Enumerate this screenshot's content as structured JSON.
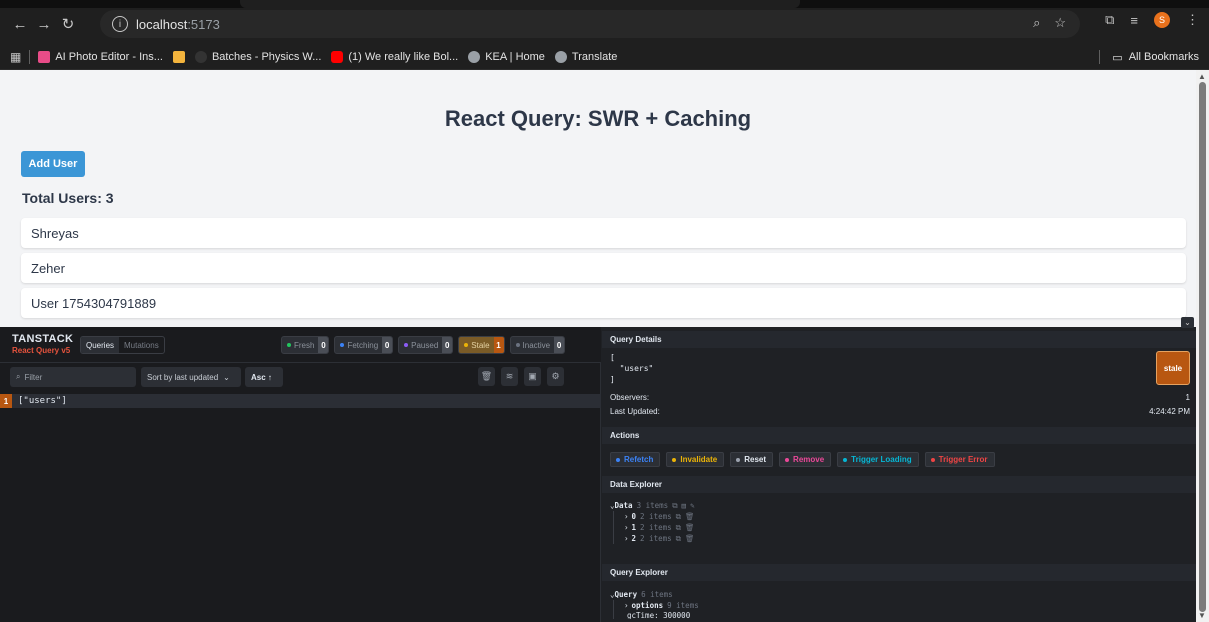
{
  "browser": {
    "url_host": "localhost",
    "url_port": ":5173",
    "bookmarks": [
      {
        "label": "AI Photo Editor - Ins...",
        "color": "#e84c88"
      },
      {
        "label": "",
        "color": "#f3b43d"
      },
      {
        "label": "Batches - Physics W...",
        "color": "#333333"
      },
      {
        "label": "(1) We really like Bol...",
        "color": "#ff0000"
      },
      {
        "label": "KEA | Home",
        "color": "#9aa0a6"
      },
      {
        "label": "Translate",
        "color": "#9aa0a6"
      }
    ],
    "all_bookmarks": "All Bookmarks",
    "avatar_letter": "S"
  },
  "page": {
    "title": "React Query: SWR + Caching",
    "add_button": "Add User",
    "total_users": "Total Users: 3",
    "users": [
      "Shreyas",
      "Zeher",
      "User 1754304791889"
    ]
  },
  "devtools": {
    "brand": "TANSTACK",
    "sub_brand": "React Query v5",
    "tabs": [
      "Queries",
      "Mutations"
    ],
    "badges": [
      {
        "label": "Fresh",
        "count": "0",
        "dot": "#22c55e"
      },
      {
        "label": "Fetching",
        "count": "0",
        "dot": "#3b82f6"
      },
      {
        "label": "Paused",
        "count": "0",
        "dot": "#8b5cf6"
      },
      {
        "label": "Stale",
        "count": "1",
        "dot": "#eab308"
      },
      {
        "label": "Inactive",
        "count": "0",
        "dot": "#6b7280"
      }
    ],
    "filter_placeholder": "Filter",
    "sort_label": "Sort by last updated",
    "asc_label": "Asc ↑",
    "query_row": {
      "count": "1",
      "key": "[\"users\"]"
    },
    "details": {
      "title": "Query Details",
      "key_text": "[\n  \"users\"\n]",
      "status": "stale",
      "observers_label": "Observers:",
      "observers_value": "1",
      "updated_label": "Last Updated:",
      "updated_value": "4:24:42 PM"
    },
    "actions_title": "Actions",
    "actions": [
      {
        "label": "Refetch",
        "color": "#3b82f6"
      },
      {
        "label": "Invalidate",
        "color": "#eab308"
      },
      {
        "label": "Reset",
        "color": "#9ca3af"
      },
      {
        "label": "Remove",
        "color": "#ec4899"
      },
      {
        "label": "Trigger Loading",
        "color": "#06b6d4"
      },
      {
        "label": "Trigger Error",
        "color": "#ef4444"
      }
    ],
    "data_explorer": {
      "title": "Data Explorer",
      "root": "Data",
      "root_count": "3 items",
      "children": [
        {
          "key": "0",
          "count": "2 items"
        },
        {
          "key": "1",
          "count": "2 items"
        },
        {
          "key": "2",
          "count": "2 items"
        }
      ]
    },
    "query_explorer": {
      "title": "Query Explorer",
      "root": "Query",
      "root_count": "6 items",
      "children": [
        {
          "key": "options",
          "count": "9 items"
        }
      ],
      "partial_line": "gcTime: 300000"
    }
  }
}
